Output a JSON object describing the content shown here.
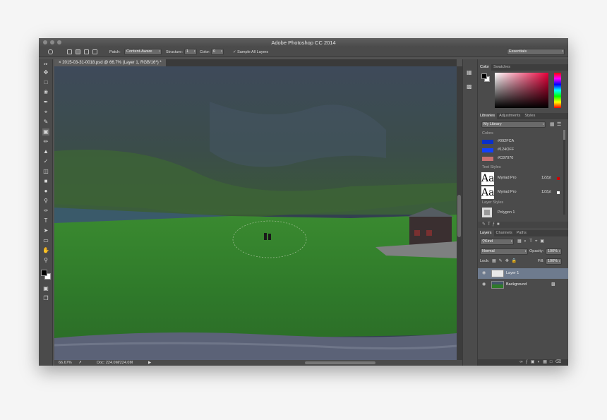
{
  "window": {
    "title": "Adobe Photoshop CC 2014"
  },
  "options_bar": {
    "patch_label": "Patch:",
    "patch_value": "Content-Aware",
    "structure_label": "Structure:",
    "structure_value": "1",
    "color_label": "Color:",
    "color_value": "0",
    "sample_all_layers": "Sample All Layers",
    "workspace": "Essentials"
  },
  "document": {
    "tab_title": "2015-03-31-0018.psd @ 66.7% (Layer 1, RGB/16*) *"
  },
  "status_bar": {
    "zoom": "66.67%",
    "doc_size": "Doc: 224.0M/224.0M"
  },
  "color_panel": {
    "tabs": [
      "Color",
      "Swatches"
    ],
    "foreground": "#000000",
    "background": "#ffffff"
  },
  "libraries_panel": {
    "tabs": [
      "Libraries",
      "Adjustments",
      "Styles"
    ],
    "library_name": "My Library",
    "colors_heading": "Colors",
    "colors": [
      {
        "label": "#092FCA",
        "hex": "#092FCA"
      },
      {
        "label": "#124OFF",
        "hex": "#1240FF"
      },
      {
        "label": "#C87070",
        "hex": "#C87070"
      }
    ],
    "text_styles_heading": "Text Styles",
    "text_styles": [
      {
        "name": "Myriad Pro",
        "size": "122pt",
        "swatch": "#cc0000"
      },
      {
        "name": "Myriad Pro",
        "size": "122pt",
        "swatch": "#ffffff"
      }
    ],
    "layer_styles_heading": "Layer Styles",
    "layer_styles": [
      {
        "name": "Polygon 1"
      }
    ]
  },
  "layers_panel": {
    "tabs": [
      "Layers",
      "Channels",
      "Paths"
    ],
    "filter_kind": "Kind",
    "blend_mode": "Normal",
    "opacity_label": "Opacity:",
    "opacity_value": "100%",
    "lock_label": "Lock:",
    "fill_label": "Fill:",
    "fill_value": "100%",
    "layers": [
      {
        "name": "Layer 1",
        "selected": true
      },
      {
        "name": "Background",
        "locked": true
      }
    ]
  }
}
